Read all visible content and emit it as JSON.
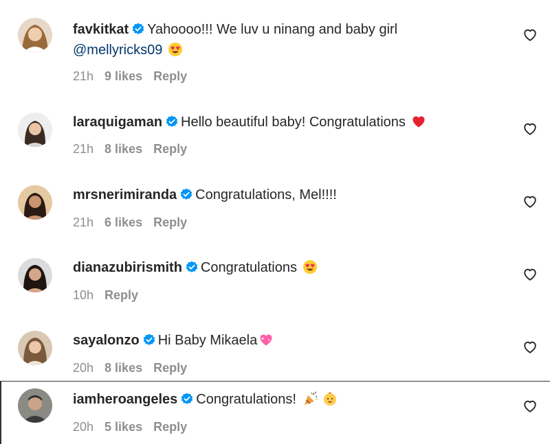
{
  "comments": [
    {
      "username": "favkitkat",
      "text": "Yahoooo!!! We luv u ninang and baby girl",
      "mention": "@mellyricks09",
      "emoji": "heart-eyes-emoji",
      "time": "21h",
      "likes": "9 likes",
      "reply": "Reply"
    },
    {
      "username": "laraquigaman",
      "text": "Hello beautiful baby! Congratulations",
      "emoji": "red-heart-emoji",
      "time": "21h",
      "likes": "8 likes",
      "reply": "Reply"
    },
    {
      "username": "mrsnerimiranda",
      "text": "Congratulations, Mel!!!!",
      "time": "21h",
      "likes": "6 likes",
      "reply": "Reply"
    },
    {
      "username": "dianazubirismith",
      "text": "Congratulations",
      "emoji": "heart-eyes-emoji",
      "time": "10h",
      "reply": "Reply"
    },
    {
      "username": "sayalonzo",
      "text": "Hi Baby Mikaela",
      "emoji": "sparkling-heart-emoji",
      "time": "20h",
      "likes": "8 likes",
      "reply": "Reply"
    },
    {
      "username": "iamheroangeles",
      "text": "Congratulations!",
      "emoji": "party-popper-emoji",
      "emoji2": "baby-emoji",
      "time": "20h",
      "likes": "5 likes",
      "reply": "Reply"
    }
  ],
  "colors": {
    "text": "#262626",
    "muted": "#8e8e8e",
    "mention": "#00376b",
    "verified": "#0095f6",
    "heart_red": "#ed4956"
  }
}
